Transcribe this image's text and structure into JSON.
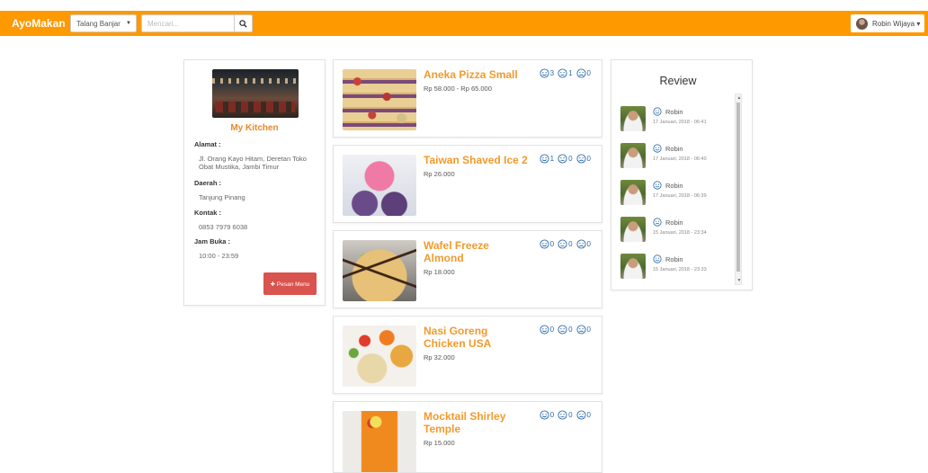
{
  "navbar": {
    "brand": "AyoMakan",
    "city_select": "Talang Banjar",
    "search_placeholder": "Mencari...",
    "user_name": "Robin Wijaya ▾",
    "accent_color": "#ff9900"
  },
  "shop": {
    "name": "My Kitchen",
    "address_label": "Alamat :",
    "address": "Jl. Orang Kayo Hitam, Deretan Toko Obat Mustika, Jambi Timur",
    "area_label": "Daerah :",
    "area": "Tanjung Pinang",
    "contact_label": "Kontak :",
    "contact": "0853 7979 6038",
    "hours_label": "Jam Buka :",
    "hours": "10:00 - 23:59",
    "order_button": "✚ Pesan Menu"
  },
  "menu": [
    {
      "name": "Aneka Pizza Small",
      "price": "Rp 58.000 - Rp 65.000",
      "happy": "3",
      "neutral": "1",
      "sad": "0"
    },
    {
      "name": "Taiwan Shaved Ice 2",
      "price": "Rp 26.000",
      "happy": "1",
      "neutral": "0",
      "sad": "0"
    },
    {
      "name": "Wafel Freeze Almond",
      "price": "Rp 18.000",
      "happy": "0",
      "neutral": "0",
      "sad": "0"
    },
    {
      "name": "Nasi Goreng Chicken USA",
      "price": "Rp 32.000",
      "happy": "0",
      "neutral": "0",
      "sad": "0"
    },
    {
      "name": "Mocktail Shirley Temple",
      "price": "Rp 15.000",
      "happy": "0",
      "neutral": "0",
      "sad": "0"
    }
  ],
  "reviews": {
    "title": "Review",
    "items": [
      {
        "name": "Robin",
        "date": "17 Januari, 2018 - 06:41",
        "mood": "happy-icon"
      },
      {
        "name": "Robin",
        "date": "17 Januari, 2018 - 06:40",
        "mood": "happy-icon"
      },
      {
        "name": "Robin",
        "date": "17 Januari, 2018 - 06:39",
        "mood": "happy-icon"
      },
      {
        "name": "Robin",
        "date": "15 Januari, 2018 - 23:34",
        "mood": "neutral-icon"
      },
      {
        "name": "Robin",
        "date": "15 Januari, 2018 - 23:33",
        "mood": "happy-icon"
      }
    ]
  },
  "icons": {
    "search": "search-icon",
    "happy": "happy-face-icon",
    "neutral": "neutral-face-icon",
    "sad": "sad-face-icon",
    "rating_color": "#2f6aa8",
    "title_color": "#f39a2c",
    "button_color": "#d9534f"
  }
}
